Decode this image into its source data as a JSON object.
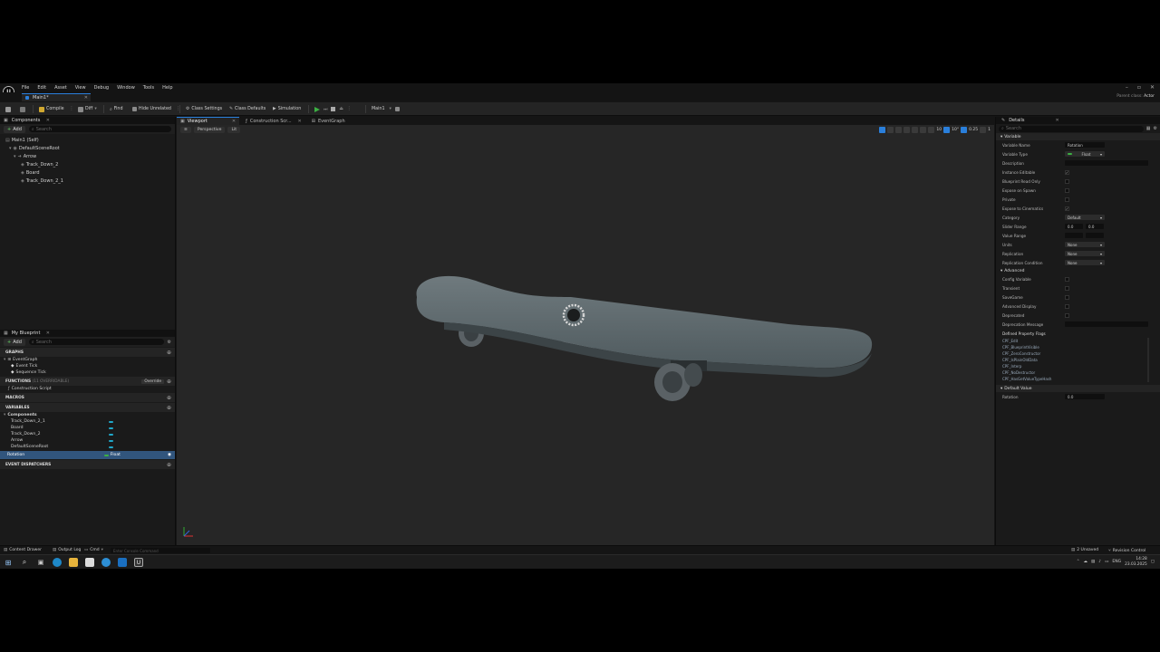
{
  "menubar": {
    "logo": "U",
    "items": [
      "File",
      "Edit",
      "Asset",
      "View",
      "Debug",
      "Window",
      "Tools",
      "Help"
    ]
  },
  "tabbar": {
    "document_tab": "Main1*",
    "parent_class_label": "Parent class:",
    "parent_class_value": "Actor"
  },
  "toolbar": {
    "compile": "Compile",
    "diff": "Diff",
    "find": "Find",
    "hide_unrelated": "Hide Unrelated",
    "class_settings": "Class Settings",
    "class_defaults": "Class Defaults",
    "simulation": "Simulation",
    "debug_object": "Main1"
  },
  "components": {
    "tab": "Components",
    "add": "Add",
    "search_placeholder": "Search",
    "self": "Main1 (Self)",
    "root": "DefaultSceneRoot",
    "children": [
      "Arrow",
      "Track_Down_2",
      "Board",
      "Track_Down_2_1"
    ]
  },
  "blueprint": {
    "tab": "My Blueprint",
    "add": "Add",
    "search_placeholder": "Search",
    "graphs_header": "GRAPHS",
    "event_graph": "EventGraph",
    "event_tick": "Event Tick",
    "sequence_tick": "Sequence Tick",
    "functions_header": "FUNCTIONS",
    "functions_count": "(11 OVERRIDABLE)",
    "override": "Override",
    "construction_script": "Construction Script",
    "macros_header": "MACROS",
    "variables_header": "VARIABLES",
    "components_group": "Components",
    "variables": [
      "Track_Down_2_1",
      "Board",
      "Track_Down_2",
      "Arrow",
      "DefaultSceneRoot"
    ],
    "selected_var": "Rotation",
    "selected_var_type": "Float",
    "dispatchers_header": "EVENT DISPATCHERS"
  },
  "viewport": {
    "tabs": [
      "Viewport",
      "Construction Scr...",
      "EventGraph"
    ],
    "perspective": "Perspective",
    "lit": "Lit",
    "grid_snap": "10",
    "rot_snap": "10°",
    "scale_snap": "0.25",
    "camera_speed": "1"
  },
  "details": {
    "tab": "Details",
    "search_placeholder": "Search",
    "variable_section": "Variable",
    "props": [
      {
        "label": "Variable Name",
        "kind": "field",
        "value": "Rotation"
      },
      {
        "label": "Variable Type",
        "kind": "type",
        "value": "Float"
      },
      {
        "label": "Description",
        "kind": "field",
        "value": ""
      },
      {
        "label": "Instance Editable",
        "kind": "check",
        "value": "✓"
      },
      {
        "label": "Blueprint Read Only",
        "kind": "check",
        "value": ""
      },
      {
        "label": "Expose on Spawn",
        "kind": "check",
        "value": ""
      },
      {
        "label": "Private",
        "kind": "check",
        "value": ""
      },
      {
        "label": "Expose to Cinematics",
        "kind": "check",
        "value": "✓"
      },
      {
        "label": "Category",
        "kind": "dropdown",
        "value": "Default"
      },
      {
        "label": "Slider Range",
        "kind": "range",
        "value": "0.0"
      },
      {
        "label": "Value Range",
        "kind": "range",
        "value": ""
      },
      {
        "label": "Units",
        "kind": "dropdown",
        "value": "None"
      },
      {
        "label": "Replication",
        "kind": "dropdown",
        "value": "None"
      },
      {
        "label": "Replication Condition",
        "kind": "dropdown",
        "value": "None"
      }
    ],
    "advanced_section": "Advanced",
    "advanced_props": [
      {
        "label": "Config Variable",
        "kind": "check",
        "value": ""
      },
      {
        "label": "Transient",
        "kind": "check",
        "value": ""
      },
      {
        "label": "SaveGame",
        "kind": "check",
        "value": ""
      },
      {
        "label": "Advanced Display",
        "kind": "check",
        "value": ""
      },
      {
        "label": "Deprecated",
        "kind": "check",
        "value": ""
      },
      {
        "label": "Deprecation Message",
        "kind": "field",
        "value": ""
      }
    ],
    "flags_header": "Defined Property Flags",
    "flags": [
      "CPF_Edit",
      "CPF_BlueprintVisible",
      "CPF_ZeroConstructor",
      "CPF_IsPlainOldData",
      "CPF_Interp",
      "CPF_NoDestructor",
      "CPF_HasGetValueTypeHash"
    ],
    "default_section": "Default Value",
    "default_label": "Rotation",
    "default_value": "0.0"
  },
  "statusbar": {
    "content_drawer": "Content Drawer",
    "output_log": "Output Log",
    "cmd": "Cmd",
    "cmd_placeholder": "Enter Console Command",
    "unsaved": "2 Unsaved",
    "revision": "Revision Control"
  },
  "taskbar": {
    "language": "ENG",
    "time": "14:28",
    "date": "23.03.2025"
  },
  "colors": {
    "accent": "#2a7fdb",
    "float_type": "#3cb043",
    "component_var": "#1fa7c9"
  }
}
